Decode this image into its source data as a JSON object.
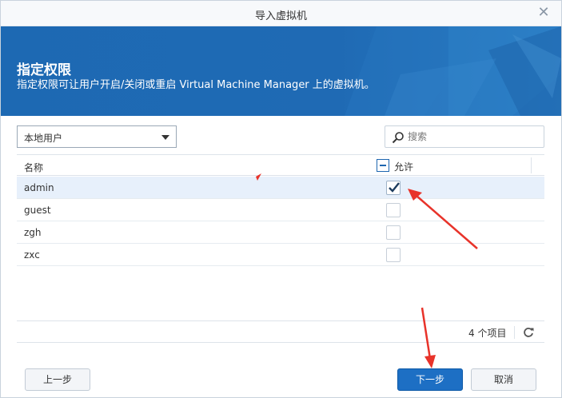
{
  "window": {
    "title": "导入虚拟机"
  },
  "banner": {
    "title": "指定权限",
    "subtitle": "指定权限可让用户开启/关闭或重启 Virtual Machine Manager 上的虚拟机。"
  },
  "filter": {
    "selected": "本地用户"
  },
  "search": {
    "placeholder": "搜索",
    "value": ""
  },
  "grid": {
    "columns": {
      "name": "名称",
      "allow": "允许"
    },
    "rows": [
      {
        "name": "admin",
        "allowed": true,
        "selected": true
      },
      {
        "name": "guest",
        "allowed": false,
        "selected": false
      },
      {
        "name": "zgh",
        "allowed": false,
        "selected": false
      },
      {
        "name": "zxc",
        "allowed": false,
        "selected": false
      }
    ],
    "count_text": "4 个项目"
  },
  "buttons": {
    "prev": "上一步",
    "next": "下一步",
    "cancel": "取消"
  },
  "colors": {
    "banner": "#1e6bb5",
    "primary": "#1d6fc4",
    "annotation": "#e8332a"
  },
  "icons": {
    "close": "close-icon",
    "search": "search-icon",
    "refresh": "refresh-icon",
    "check": "checkmark-icon",
    "dropdown": "chevron-down-icon"
  }
}
